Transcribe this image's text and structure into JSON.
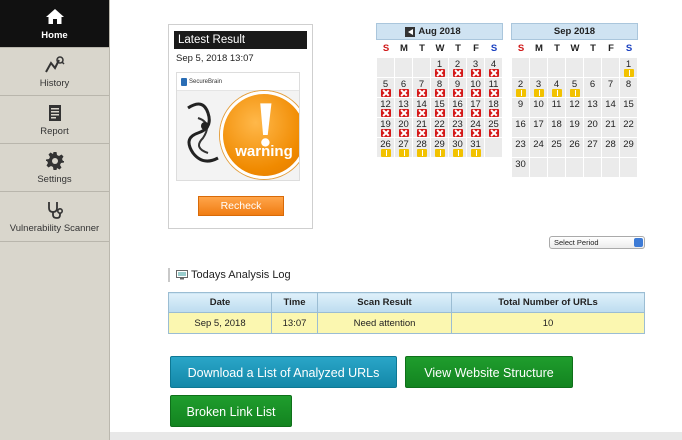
{
  "sidebar": {
    "items": [
      {
        "label": "Home",
        "icon": "home-icon",
        "active": true
      },
      {
        "label": "History",
        "icon": "history-icon",
        "active": false
      },
      {
        "label": "Report",
        "icon": "report-icon",
        "active": false
      },
      {
        "label": "Settings",
        "icon": "gear-icon",
        "active": false
      },
      {
        "label": "Vulnerability Scanner",
        "icon": "stethoscope-icon",
        "active": false
      }
    ]
  },
  "latest_result": {
    "title": "Latest Result",
    "date": "Sep 5, 2018 13:07",
    "thumbnail_logo": "SecureBrain",
    "status": "warning",
    "recheck_label": "Recheck"
  },
  "calendars": [
    {
      "month": "Aug 2018",
      "has_prev": true,
      "dow": [
        "S",
        "M",
        "T",
        "W",
        "T",
        "F",
        "S"
      ],
      "weeks": [
        [
          {
            "d": ""
          },
          {
            "d": ""
          },
          {
            "d": ""
          },
          {
            "d": "1",
            "m": "x"
          },
          {
            "d": "2",
            "m": "x"
          },
          {
            "d": "3",
            "m": "x"
          },
          {
            "d": "4",
            "m": "x"
          }
        ],
        [
          {
            "d": "5",
            "m": "x"
          },
          {
            "d": "6",
            "m": "x"
          },
          {
            "d": "7",
            "m": "x"
          },
          {
            "d": "8",
            "m": "x"
          },
          {
            "d": "9",
            "m": "x"
          },
          {
            "d": "10",
            "m": "x"
          },
          {
            "d": "11",
            "m": "x"
          }
        ],
        [
          {
            "d": "12",
            "m": "x"
          },
          {
            "d": "13",
            "m": "x"
          },
          {
            "d": "14",
            "m": "x"
          },
          {
            "d": "15",
            "m": "x"
          },
          {
            "d": "16",
            "m": "x"
          },
          {
            "d": "17",
            "m": "x"
          },
          {
            "d": "18",
            "m": "x"
          }
        ],
        [
          {
            "d": "19",
            "m": "x"
          },
          {
            "d": "20",
            "m": "x"
          },
          {
            "d": "21",
            "m": "x"
          },
          {
            "d": "22",
            "m": "x"
          },
          {
            "d": "23",
            "m": "x"
          },
          {
            "d": "24",
            "m": "x"
          },
          {
            "d": "25",
            "m": "x"
          }
        ],
        [
          {
            "d": "26",
            "m": "w"
          },
          {
            "d": "27",
            "m": "w"
          },
          {
            "d": "28",
            "m": "w"
          },
          {
            "d": "29",
            "m": "w"
          },
          {
            "d": "30",
            "m": "w"
          },
          {
            "d": "31",
            "m": "w"
          },
          {
            "d": ""
          }
        ]
      ]
    },
    {
      "month": "Sep 2018",
      "has_prev": false,
      "dow": [
        "S",
        "M",
        "T",
        "W",
        "T",
        "F",
        "S"
      ],
      "weeks": [
        [
          {
            "d": ""
          },
          {
            "d": ""
          },
          {
            "d": ""
          },
          {
            "d": ""
          },
          {
            "d": ""
          },
          {
            "d": ""
          },
          {
            "d": "1",
            "m": "w"
          }
        ],
        [
          {
            "d": "2",
            "m": "w"
          },
          {
            "d": "3",
            "m": "w"
          },
          {
            "d": "4",
            "m": "w"
          },
          {
            "d": "5",
            "m": "w"
          },
          {
            "d": "6"
          },
          {
            "d": "7"
          },
          {
            "d": "8"
          }
        ],
        [
          {
            "d": "9"
          },
          {
            "d": "10"
          },
          {
            "d": "11"
          },
          {
            "d": "12"
          },
          {
            "d": "13"
          },
          {
            "d": "14"
          },
          {
            "d": "15"
          }
        ],
        [
          {
            "d": "16"
          },
          {
            "d": "17"
          },
          {
            "d": "18"
          },
          {
            "d": "19"
          },
          {
            "d": "20"
          },
          {
            "d": "21"
          },
          {
            "d": "22"
          }
        ],
        [
          {
            "d": "23"
          },
          {
            "d": "24"
          },
          {
            "d": "25"
          },
          {
            "d": "26"
          },
          {
            "d": "27"
          },
          {
            "d": "28"
          },
          {
            "d": "29"
          }
        ],
        [
          {
            "d": "30"
          },
          {
            "d": ""
          },
          {
            "d": ""
          },
          {
            "d": ""
          },
          {
            "d": ""
          },
          {
            "d": ""
          },
          {
            "d": ""
          }
        ]
      ]
    }
  ],
  "select_period": {
    "value": "Select Period"
  },
  "analysis_log": {
    "title": "Todays Analysis Log",
    "columns": [
      "Date",
      "Time",
      "Scan Result",
      "Total Number of URLs"
    ],
    "rows": [
      [
        "Sep 5, 2018",
        "13:07",
        "Need attention",
        "10"
      ]
    ]
  },
  "actions": {
    "download_label": "Download a List of Analyzed URLs",
    "structure_label": "View Website Structure",
    "broken_label": "Broken Link List"
  },
  "colors": {
    "accent_blue": "#1b98bb",
    "accent_green": "#199028",
    "warning_orange": "#f08a00",
    "error_red": "#d41818",
    "caution_yellow": "#f2c200"
  }
}
